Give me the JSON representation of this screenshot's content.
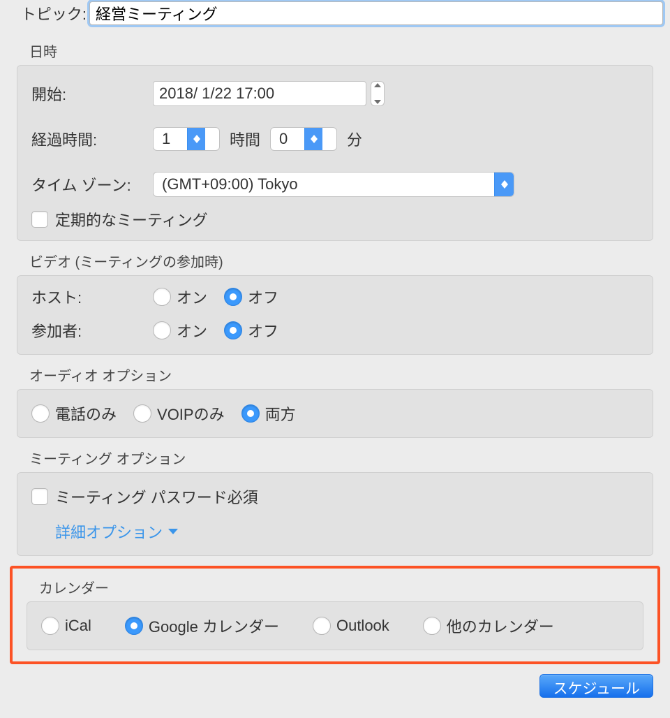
{
  "topic": {
    "label": "トピック:",
    "value": "経営ミーティング"
  },
  "date_time": {
    "section": "日時",
    "start_label": "開始:",
    "start_value": "2018/  1/22 17:00",
    "duration_label": "経過時間:",
    "hours_value": "1",
    "hours_unit": "時間",
    "minutes_value": "0",
    "minutes_unit": "分",
    "timezone_label": "タイム ゾーン:",
    "timezone_value": "(GMT+09:00) Tokyo",
    "recurring_label": "定期的なミーティング",
    "recurring_checked": false
  },
  "video": {
    "section": "ビデオ (ミーティングの参加時)",
    "host_label": "ホスト:",
    "participant_label": "参加者:",
    "on": "オン",
    "off": "オフ",
    "host_selected": "off",
    "participant_selected": "off"
  },
  "audio": {
    "section": "オーディオ オプション",
    "phone_only": "電話のみ",
    "voip_only": "VOIPのみ",
    "both": "両方",
    "selected": "both"
  },
  "meeting_options": {
    "section": "ミーティング オプション",
    "password_required_label": "ミーティング パスワード必須",
    "password_required_checked": false,
    "advanced_label": "詳細オプション"
  },
  "calendar": {
    "section": "カレンダー",
    "ical": "iCal",
    "google": "Google カレンダー",
    "outlook": "Outlook",
    "other": "他のカレンダー",
    "selected": "google"
  },
  "footer": {
    "schedule": "スケジュール"
  }
}
